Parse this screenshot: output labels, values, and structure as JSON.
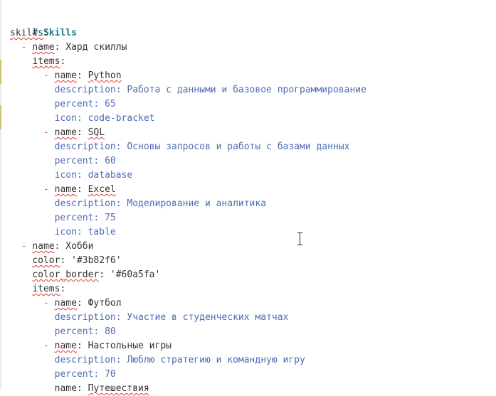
{
  "editor": {
    "heading": "# Skills",
    "lines": [
      {
        "key": "skills",
        "sep": ":"
      },
      {
        "dash": "- ",
        "key": "name",
        "sep": ": ",
        "val": "Хард скиллы"
      },
      {
        "key": "items",
        "sep": ":"
      },
      {
        "dash": "- ",
        "key": "name",
        "sep": ": ",
        "val": "Python"
      },
      {
        "key": "description",
        "sep": ": ",
        "val": "Работа с данными и базовое программирование"
      },
      {
        "key": "percent",
        "sep": ": ",
        "val": "65"
      },
      {
        "key": "icon",
        "sep": ": ",
        "val": "code-bracket"
      },
      {
        "dash": "- ",
        "key": "name",
        "sep": ": ",
        "val": "SQL"
      },
      {
        "key": "description",
        "sep": ": ",
        "val": "Основы запросов и работы с базами данных"
      },
      {
        "key": "percent",
        "sep": ": ",
        "val": "60"
      },
      {
        "key": "icon",
        "sep": ": ",
        "val": "database"
      },
      {
        "dash": "- ",
        "key": "name",
        "sep": ": ",
        "val": "Excel"
      },
      {
        "key": "description",
        "sep": ": ",
        "val": "Моделирование и аналитика"
      },
      {
        "key": "percent",
        "sep": ": ",
        "val": "75"
      },
      {
        "key": "icon",
        "sep": ": ",
        "val": "table"
      },
      {
        "dash": "- ",
        "key": "name",
        "sep": ": ",
        "val": "Хобби"
      },
      {
        "key": "color",
        "sep": ": ",
        "val": "'#3b82f6'"
      },
      {
        "key": "color_border",
        "sep": ": ",
        "val": "'#60a5fa'"
      },
      {
        "key": "items",
        "sep": ":"
      },
      {
        "dash": "- ",
        "key": "name",
        "sep": ": ",
        "val": "Футбол"
      },
      {
        "key": "description",
        "sep": ": ",
        "val": "Участие в студенческих матчах"
      },
      {
        "key": "percent",
        "sep": ": ",
        "val": "80"
      },
      {
        "dash": "- ",
        "key": "name",
        "sep": ": ",
        "val": "Настольные игры"
      },
      {
        "key": "description",
        "sep": ": ",
        "val": "Люблю стратегию и командную игру"
      },
      {
        "key": "percent",
        "sep": ": ",
        "val": "70"
      },
      {
        "key": "name",
        "sep": ": ",
        "val": "Путешествия"
      }
    ]
  },
  "colors": {
    "key": "#333333",
    "value": "#4f6bb5",
    "dash": "#e45649",
    "heading": "#1f7a8c"
  }
}
